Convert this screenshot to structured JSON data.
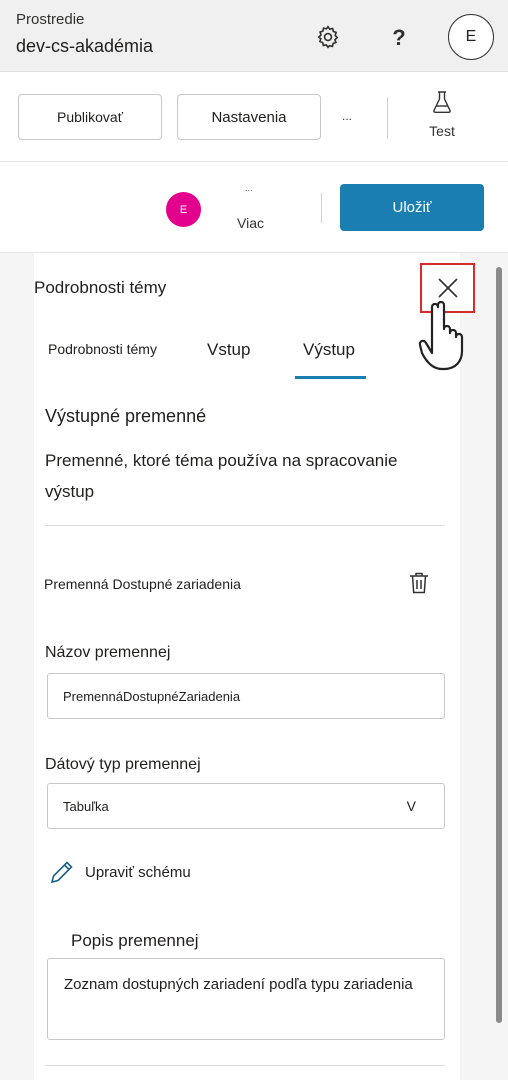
{
  "header": {
    "env_label": "Prostredie",
    "env_name": "dev-cs-akadémia",
    "help_label": "?",
    "avatar_initial": "E"
  },
  "commandbar": {
    "publish_label": "Publikovať",
    "settings_label": "Nastavenia",
    "more_label": "...",
    "test_label": "Test"
  },
  "savebar": {
    "avatar_initial": "E",
    "more_dots": "...",
    "more_label": "Viac",
    "save_label": "Uložiť",
    "save_color": "#1a7fb0"
  },
  "panel": {
    "title": "Podrobnosti témy",
    "tabs": [
      {
        "label": "Podrobnosti témy"
      },
      {
        "label": "Vstup"
      },
      {
        "label": "Výstup",
        "selected": true
      }
    ],
    "section_title": "Výstupné premenné",
    "section_desc": "Premenné, ktoré téma používa na spracovanie výstup",
    "variable": {
      "heading": "Premenná Dostupné zariadenia",
      "name_label": "Názov premennej",
      "name_value": "PremennáDostupnéZariadenia",
      "type_label": "Dátový typ premennej",
      "type_value": "Tabuľka",
      "type_chevron": "V",
      "edit_schema_label": "Upraviť schému",
      "desc_label": "Popis premennej",
      "desc_value": "Zoznam dostupných zariadení podľa typu zariadenia"
    }
  }
}
